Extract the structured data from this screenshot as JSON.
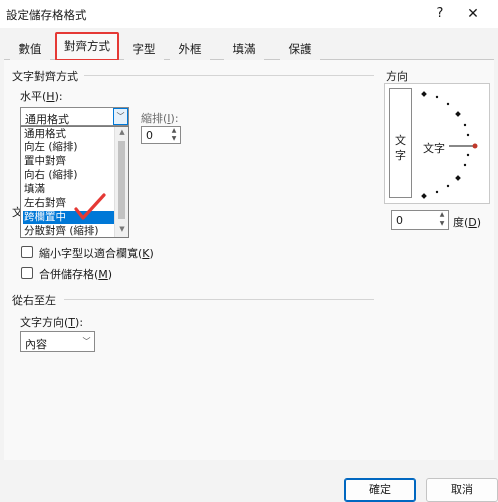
{
  "window": {
    "title": "設定儲存格格式",
    "help_icon": "?",
    "close_icon": "✕"
  },
  "tabs": [
    {
      "label": "數值"
    },
    {
      "label": "對齊方式",
      "active": true
    },
    {
      "label": "字型"
    },
    {
      "label": "外框"
    },
    {
      "label": "填滿"
    },
    {
      "label": "保護"
    }
  ],
  "text_alignment": {
    "group_title": "文字對齊方式",
    "horizontal_label": "水平(",
    "horizontal_key": "H",
    "horizontal_label_end": "):",
    "horizontal_value": "通用格式",
    "indent_label": "縮排(",
    "indent_key": "I",
    "indent_label_end": "):",
    "indent_value": "0",
    "vertical_label_partial": "文"
  },
  "dropdown": {
    "items": [
      "通用格式",
      "向左 (縮排)",
      "置中對齊",
      "向右 (縮排)",
      "填滿",
      "左右對齊",
      "跨欄置中",
      "分散對齊 (縮排)"
    ],
    "selected_index": 6
  },
  "text_control": {
    "shrink_label": "縮小字型以適合欄寬(",
    "shrink_key": "K",
    "shrink_end": ")",
    "merge_label": "合併儲存格(",
    "merge_key": "M",
    "merge_end": ")"
  },
  "rtl": {
    "group_title": "從右至左",
    "direction_label": "文字方向(",
    "direction_key": "T",
    "direction_end": "):",
    "direction_value": "內容"
  },
  "orientation": {
    "group_title": "方向",
    "vertical_chars": [
      "文",
      "字"
    ],
    "dial_text": "文字",
    "degrees_value": "0",
    "degrees_label": "度(",
    "degrees_key": "D",
    "degrees_end": ")"
  },
  "footer": {
    "ok_label": "確定",
    "cancel_label": "取消"
  },
  "colors": {
    "accent": "#0078d7",
    "highlight_red": "#e53935",
    "check_red": "#e53935"
  }
}
